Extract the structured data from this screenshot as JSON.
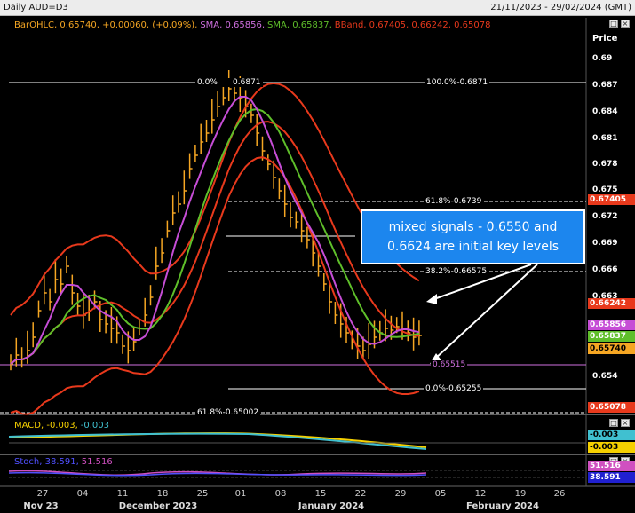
{
  "titlebar": {
    "symbol": "Daily AUD=D3",
    "date_range": "21/11/2023 - 29/02/2024 (GMT)"
  },
  "main_legend": {
    "ohlc": "BarOHLC, 0.65740, +0.00060, (+0.09%),",
    "sma1": "SMA, 0.65856,",
    "sma2": "SMA, 0.65837,",
    "bband": "BBand, 0.67405, 0.66242, 0.65078"
  },
  "price_axis": {
    "title": "Price",
    "ticks": [
      "0.69",
      "0.687",
      "0.684",
      "0.681",
      "0.678",
      "0.675",
      "0.672",
      "0.669",
      "0.666",
      "0.663",
      "0.657",
      "0.654"
    ],
    "badges": [
      {
        "label": "0.67405",
        "bg": "#e8391c",
        "fg": "#ffffff"
      },
      {
        "label": "0.66242",
        "bg": "#e8391c",
        "fg": "#ffffff"
      },
      {
        "label": "0.65856",
        "bg": "#c64dd6",
        "fg": "#ffffff"
      },
      {
        "label": "0.65837",
        "bg": "#5fbf2a",
        "fg": "#ffffff"
      },
      {
        "label": "0.65740",
        "bg": "#f5a623",
        "fg": "#000000"
      },
      {
        "label": "0.65078",
        "bg": "#e8391c",
        "fg": "#ffffff"
      }
    ]
  },
  "fibonacci": {
    "top_left": "0.0%",
    "top_left_value": "0.6871",
    "top_right": "100.0%-0.6871",
    "f618": "61.8%-0.6739",
    "f382": "38.2%-0.66575",
    "f0": "0.0%-0.65255",
    "f618_low": "61.8%-0.65002",
    "support_label": "0.65515"
  },
  "callout": {
    "line1": "mixed signals - 0.6550 and",
    "line2": "0.6624 are initial key levels"
  },
  "macd": {
    "title": "MACD, -0.003,",
    "value2": "-0.003",
    "badge1": "-0.003",
    "badge2": "-0.003"
  },
  "stoch": {
    "title": "Stoch, 38.591,",
    "value2": "51.516",
    "badge1": "51.516",
    "badge2": "38.591"
  },
  "x_axis": {
    "ticks": [
      "27",
      "04",
      "11",
      "18",
      "25",
      "01",
      "08",
      "15",
      "22",
      "29",
      "05",
      "12",
      "19",
      "26"
    ],
    "months": [
      "Nov 23",
      "December 2023",
      "January 2024",
      "February 2024"
    ]
  },
  "colors": {
    "bars": "#f5a623",
    "sma_fast": "#c64dd6",
    "sma_slow": "#5fbf2a",
    "bband": "#e8391c",
    "callout": "#1c86ee"
  }
}
